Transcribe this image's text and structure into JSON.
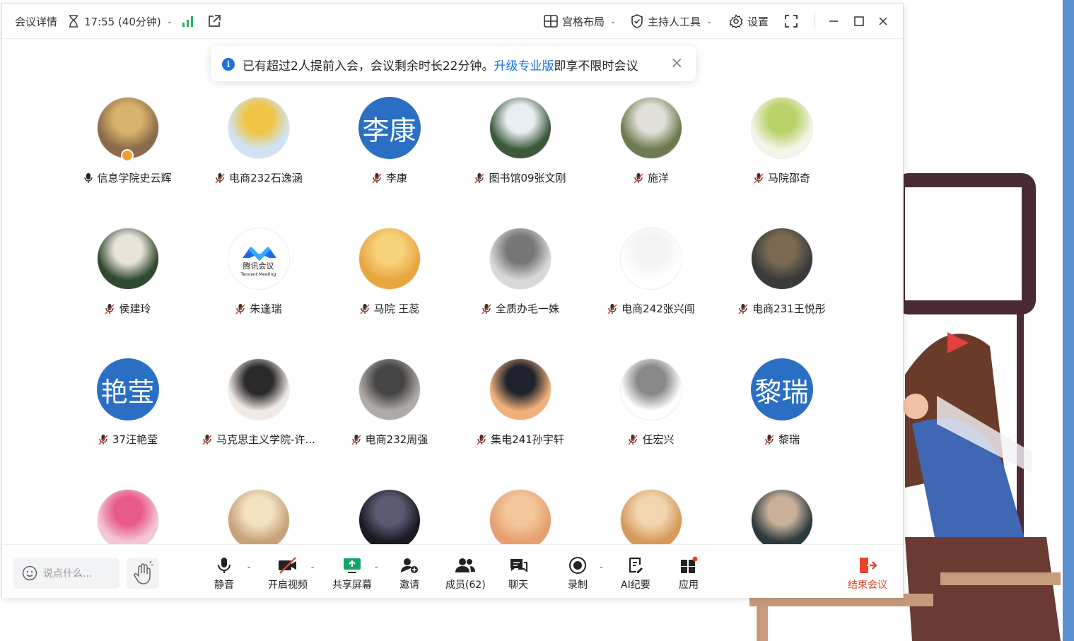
{
  "titlebar": {
    "meeting_details": "会议详情",
    "time": "17:55 (40分钟)",
    "layout": "宫格布局",
    "host_tools": "主持人工具",
    "settings": "设置"
  },
  "notice": {
    "text_before": "已有超过2人提前入会，会议剩余时长22分钟。",
    "link": "升级专业版",
    "text_after": "即享不限时会议"
  },
  "participants": [
    {
      "name": "信息学院史云辉",
      "muted": false,
      "avatar_text": ""
    },
    {
      "name": "电商232石逸涵",
      "muted": true,
      "avatar_text": ""
    },
    {
      "name": "李康",
      "muted": true,
      "avatar_text": "李康"
    },
    {
      "name": "图书馆09张文刚",
      "muted": true,
      "avatar_text": ""
    },
    {
      "name": "施洋",
      "muted": true,
      "avatar_text": ""
    },
    {
      "name": "马院邵奇",
      "muted": true,
      "avatar_text": ""
    },
    {
      "name": "侯建玲",
      "muted": true,
      "avatar_text": ""
    },
    {
      "name": "朱逢瑞",
      "muted": true,
      "avatar_text": ""
    },
    {
      "name": "马院 王蕊",
      "muted": true,
      "avatar_text": ""
    },
    {
      "name": "全质办毛一姝",
      "muted": true,
      "avatar_text": ""
    },
    {
      "name": "电商242张兴闯",
      "muted": true,
      "avatar_text": ""
    },
    {
      "name": "电商231王悦彤",
      "muted": true,
      "avatar_text": ""
    },
    {
      "name": "37汪艳莹",
      "muted": true,
      "avatar_text": "艳莹"
    },
    {
      "name": "马克思主义学院-许...",
      "muted": true,
      "avatar_text": ""
    },
    {
      "name": "电商232周强",
      "muted": true,
      "avatar_text": ""
    },
    {
      "name": "集电241孙宇轩",
      "muted": true,
      "avatar_text": ""
    },
    {
      "name": "任宏兴",
      "muted": true,
      "avatar_text": ""
    },
    {
      "name": "黎瑞",
      "muted": true,
      "avatar_text": "黎瑞"
    },
    {
      "name": "",
      "muted": true,
      "avatar_text": ""
    },
    {
      "name": "",
      "muted": true,
      "avatar_text": ""
    },
    {
      "name": "",
      "muted": true,
      "avatar_text": ""
    },
    {
      "name": "",
      "muted": true,
      "avatar_text": ""
    },
    {
      "name": "",
      "muted": true,
      "avatar_text": ""
    },
    {
      "name": "",
      "muted": true,
      "avatar_text": ""
    }
  ],
  "tencent_logo_text": {
    "line1": "腾讯会议",
    "line2": "Tencent Meeting"
  },
  "toolbar": {
    "chat_placeholder": "说点什么...",
    "mute": "静音",
    "video": "开启视频",
    "share": "共享屏幕",
    "invite": "邀请",
    "members": "成员(62)",
    "chat": "聊天",
    "record": "录制",
    "ai_minutes": "AI纪要",
    "apps": "应用",
    "end": "结束会议"
  },
  "colors": {
    "accent": "#1b6fe8",
    "text_avatar": "#2a6fc4",
    "danger": "#e8452c",
    "signal": "#22b35e"
  }
}
